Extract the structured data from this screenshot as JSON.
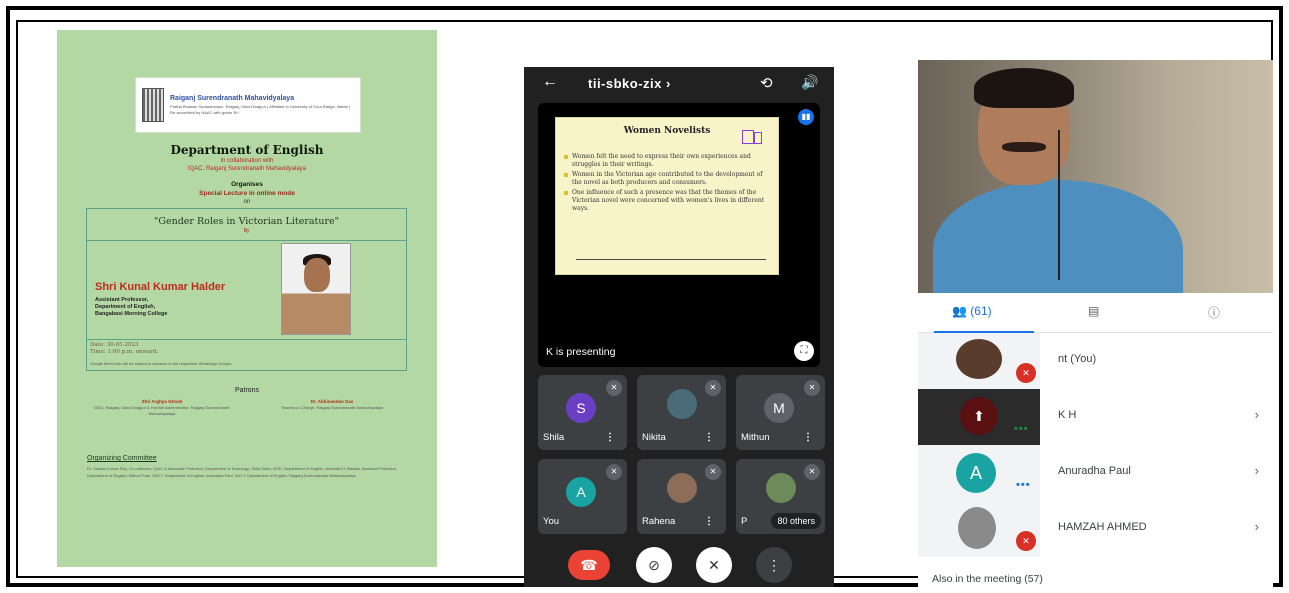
{
  "poster": {
    "college_name": "Raiganj Surendranath Mahavidyalaya",
    "college_subtitle": "Pratha Bhawan Sudarshanpur, Raiganj, Uttar Dinajpur | Affiliated to University of Gour Banga, Malda | Re-accredited by NAAC with grade 'B+'",
    "department": "Department of English",
    "collab_line1": "In collaboration with",
    "collab_line2": "IQAC, Raiganj Surendranath Mahavidyalaya",
    "organises": "Organises",
    "special_lecture": "Special Lecture in online mode",
    "on": "on",
    "lecture_title": "\"Gender Roles in Victorian Literature\"",
    "by": "By",
    "speaker": "Shri Kunal Kumar Halder",
    "designation": [
      "Assistant Professor,",
      "Department of English,",
      "Bangabasi Morning College"
    ],
    "date": "Date: 30-05-2023",
    "time": "Time: 1:00 p.m. onward.",
    "gmeet_note": "Google Meet Link will be shared in advance in the respective WhatsApp Groups",
    "patrons_heading": "Patrons",
    "patron1_name": "Shri Arghya Ghosh",
    "patron1_role": "DDO, Raiganj, Uttar Dinajpur & Hon'ble Administrator, Raiganj Surendranath Mahavidyalaya",
    "patron2_name": "Dr. Abhinandan Das",
    "patron2_role": "Teacher-in-Charge, Raiganj Surendranath Mahavidyalaya",
    "committee_heading": "Organizing Committee",
    "committee_text": "Dr. Sankar Kumar Roy, Co-ordinator, IQAC & Associate Professor, Department of Sociology; Shila Saha, HOD, Department of English; Anindita Kr. Biswas, Assistant Professor, Department of English; Mithun Paul, SACT, Department of English; Anuradha Paul, SACT, Department of English, Raiganj Surendranath Mahavidyalaya"
  },
  "phone": {
    "meeting_code": "tii-sbko-zix",
    "main_tile": {
      "slide_title": "Women Novelists",
      "slide_points": [
        "Women felt the need to express their own experiences and struggles in their writings.",
        "Women in the Victorian age contributed to the development of the novel as both producers and consumers.",
        "One influence of such a presence was that the themes of the Victorian novel were concerned with women's lives in different ways."
      ],
      "presenting_label": "K is presenting"
    },
    "tiles": [
      {
        "name": "Shila",
        "initial": "S",
        "color": "#6a3fc3",
        "type": "initial"
      },
      {
        "name": "Nikita",
        "type": "photo"
      },
      {
        "name": "Mithun",
        "initial": "M",
        "color": "#5f6368",
        "type": "initial"
      },
      {
        "name": "You",
        "initial": "A",
        "color": "#1aa3a3",
        "type": "initial"
      },
      {
        "name": "Rahena",
        "type": "photo"
      },
      {
        "name": "P",
        "others": "80 others",
        "type": "photo"
      }
    ],
    "more_symbol": "⋮"
  },
  "panel": {
    "people_count": "(61)",
    "participants": [
      {
        "name": "nt (You)",
        "muted": true
      },
      {
        "name": "K H",
        "speaking": true
      },
      {
        "name": "Anuradha Paul",
        "initial": "A",
        "speaking": true
      },
      {
        "name": "HAMZAH AHMED",
        "muted": true
      }
    ],
    "also_in_meeting": "Also in the meeting (57)"
  },
  "colors": {
    "poster_bg": "#b4d8a4",
    "meet_blue": "#1a73e8",
    "end_call_red": "#ea4335",
    "tile_bg": "#3c4043"
  }
}
